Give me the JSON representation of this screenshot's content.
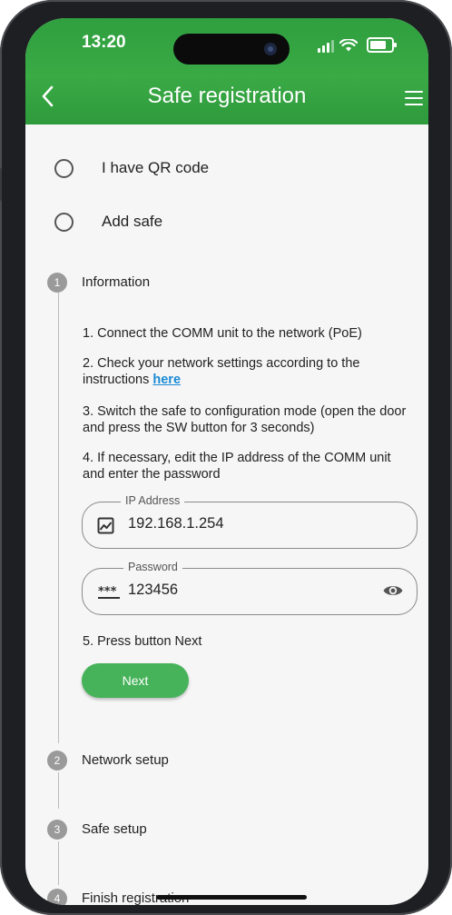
{
  "status_bar": {
    "time": "13:20"
  },
  "header": {
    "title": "Safe registration"
  },
  "options": [
    {
      "label": "I have QR code"
    },
    {
      "label": "Add safe"
    }
  ],
  "steps": [
    {
      "number": "1",
      "label": "Information"
    },
    {
      "number": "2",
      "label": "Network setup"
    },
    {
      "number": "3",
      "label": "Safe setup"
    },
    {
      "number": "4",
      "label": "Finish registration"
    }
  ],
  "instructions": {
    "p1": "1. Connect the COMM unit to the network (PoE)",
    "p2_text": "2. Check your network settings according to the instructions ",
    "p2_link": "here",
    "p3": "3. Switch the safe to configuration mode (open the door and press the SW button for 3 seconds)",
    "p4": "4. If necessary, edit the IP address of the COMM unit and enter the password",
    "p5": "5. Press button Next"
  },
  "ip_field": {
    "label": "IP Address",
    "value": "192.168.1.254"
  },
  "password_field": {
    "label": "Password",
    "value": "123456"
  },
  "next_button": {
    "label": "Next"
  },
  "colors": {
    "header_green": "#3aaa45",
    "button_green": "#46b35a",
    "link_blue": "#1a8ad6"
  }
}
